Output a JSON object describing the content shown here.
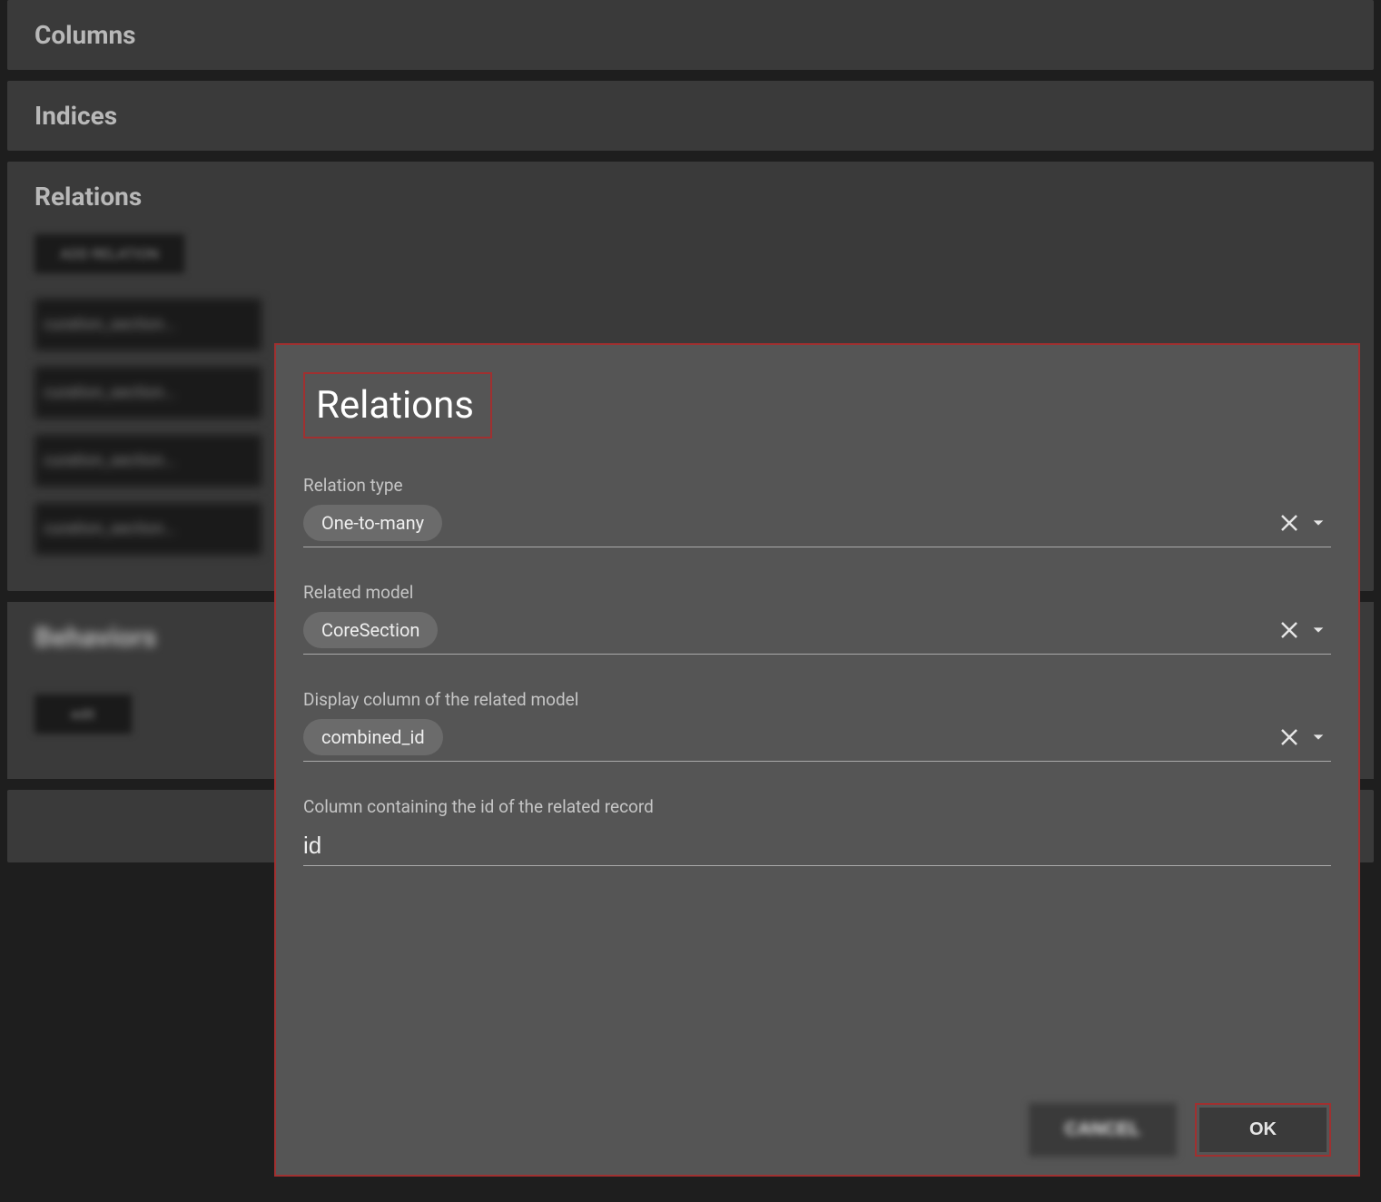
{
  "panels": {
    "columns_title": "Columns",
    "indices_title": "Indices",
    "relations_title": "Relations",
    "behaviors_title": "Behaviors"
  },
  "blurred": {
    "add_relation": "ADD RELATION",
    "item1": "curation_section...",
    "item2": "curation_section...",
    "item3": "curation_section...",
    "item4": "curation_section...",
    "edit_btn": "edit",
    "cancel": "CANCEL"
  },
  "dialog": {
    "title": "Relations",
    "relation_type_label": "Relation type",
    "relation_type_value": "One-to-many",
    "related_model_label": "Related model",
    "related_model_value": "CoreSection",
    "display_column_label": "Display column of the related model",
    "display_column_value": "combined_id",
    "id_column_label": "Column containing the id of the related record",
    "id_column_value": "id",
    "ok_label": "OK"
  }
}
